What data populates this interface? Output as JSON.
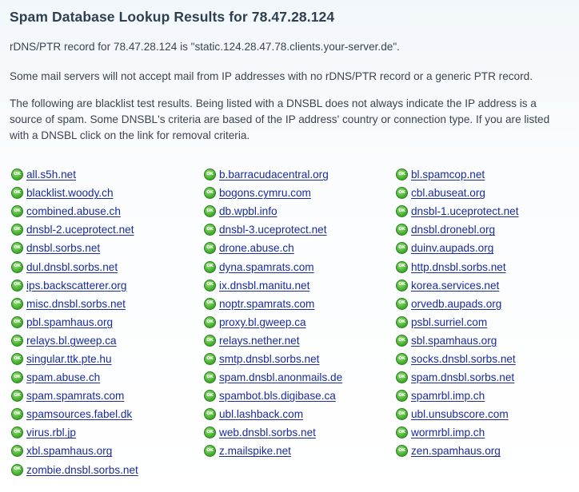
{
  "heading": "Spam Database Lookup Results for 78.47.28.124",
  "paragraphs": {
    "rdns": "rDNS/PTR record for 78.47.28.124 is \"static.124.28.47.78.clients.your-server.de\".",
    "ptr_note": "Some mail servers will not accept mail from IP addresses with no rDNS/PTR record or a generic PTR record.",
    "blacklist_note": "The following are blacklist test results. Being listed with a DNSBL does not always indicate the IP address is a source of spam. Some DNSBL's criteria are based of the IP address' country or connection type. If you are listed with a DNSBL click on the link for removal criteria."
  },
  "status_icon": {
    "name": "ok-icon",
    "label": "OK",
    "color": "#4bb534"
  },
  "link_color": "#1a2b9c",
  "dnsbl_results": [
    {
      "name": "all.s5h.net",
      "status": "OK"
    },
    {
      "name": "b.barracudacentral.org",
      "status": "OK"
    },
    {
      "name": "bl.spamcop.net",
      "status": "OK"
    },
    {
      "name": "blacklist.woody.ch",
      "status": "OK"
    },
    {
      "name": "bogons.cymru.com",
      "status": "OK"
    },
    {
      "name": "cbl.abuseat.org",
      "status": "OK"
    },
    {
      "name": "combined.abuse.ch",
      "status": "OK"
    },
    {
      "name": "db.wpbl.info",
      "status": "OK"
    },
    {
      "name": "dnsbl-1.uceprotect.net",
      "status": "OK"
    },
    {
      "name": "dnsbl-2.uceprotect.net",
      "status": "OK"
    },
    {
      "name": "dnsbl-3.uceprotect.net",
      "status": "OK"
    },
    {
      "name": "dnsbl.dronebl.org",
      "status": "OK"
    },
    {
      "name": "dnsbl.sorbs.net",
      "status": "OK"
    },
    {
      "name": "drone.abuse.ch",
      "status": "OK"
    },
    {
      "name": "duinv.aupads.org",
      "status": "OK"
    },
    {
      "name": "dul.dnsbl.sorbs.net",
      "status": "OK"
    },
    {
      "name": "dyna.spamrats.com",
      "status": "OK"
    },
    {
      "name": "http.dnsbl.sorbs.net",
      "status": "OK"
    },
    {
      "name": "ips.backscatterer.org",
      "status": "OK"
    },
    {
      "name": "ix.dnsbl.manitu.net",
      "status": "OK"
    },
    {
      "name": "korea.services.net",
      "status": "OK"
    },
    {
      "name": "misc.dnsbl.sorbs.net",
      "status": "OK"
    },
    {
      "name": "noptr.spamrats.com",
      "status": "OK"
    },
    {
      "name": "orvedb.aupads.org",
      "status": "OK"
    },
    {
      "name": "pbl.spamhaus.org",
      "status": "OK"
    },
    {
      "name": "proxy.bl.gweep.ca",
      "status": "OK"
    },
    {
      "name": "psbl.surriel.com",
      "status": "OK"
    },
    {
      "name": "relays.bl.gweep.ca",
      "status": "OK"
    },
    {
      "name": "relays.nether.net",
      "status": "OK"
    },
    {
      "name": "sbl.spamhaus.org",
      "status": "OK"
    },
    {
      "name": "singular.ttk.pte.hu",
      "status": "OK"
    },
    {
      "name": "smtp.dnsbl.sorbs.net",
      "status": "OK"
    },
    {
      "name": "socks.dnsbl.sorbs.net",
      "status": "OK"
    },
    {
      "name": "spam.abuse.ch",
      "status": "OK"
    },
    {
      "name": "spam.dnsbl.anonmails.de",
      "status": "OK"
    },
    {
      "name": "spam.dnsbl.sorbs.net",
      "status": "OK"
    },
    {
      "name": "spam.spamrats.com",
      "status": "OK"
    },
    {
      "name": "spambot.bls.digibase.ca",
      "status": "OK"
    },
    {
      "name": "spamrbl.imp.ch",
      "status": "OK"
    },
    {
      "name": "spamsources.fabel.dk",
      "status": "OK"
    },
    {
      "name": "ubl.lashback.com",
      "status": "OK"
    },
    {
      "name": "ubl.unsubscore.com",
      "status": "OK"
    },
    {
      "name": "virus.rbl.jp",
      "status": "OK"
    },
    {
      "name": "web.dnsbl.sorbs.net",
      "status": "OK"
    },
    {
      "name": "wormrbl.imp.ch",
      "status": "OK"
    },
    {
      "name": "xbl.spamhaus.org",
      "status": "OK"
    },
    {
      "name": "z.mailspike.net",
      "status": "OK"
    },
    {
      "name": "zen.spamhaus.org",
      "status": "OK"
    },
    {
      "name": "zombie.dnsbl.sorbs.net",
      "status": "OK"
    }
  ]
}
